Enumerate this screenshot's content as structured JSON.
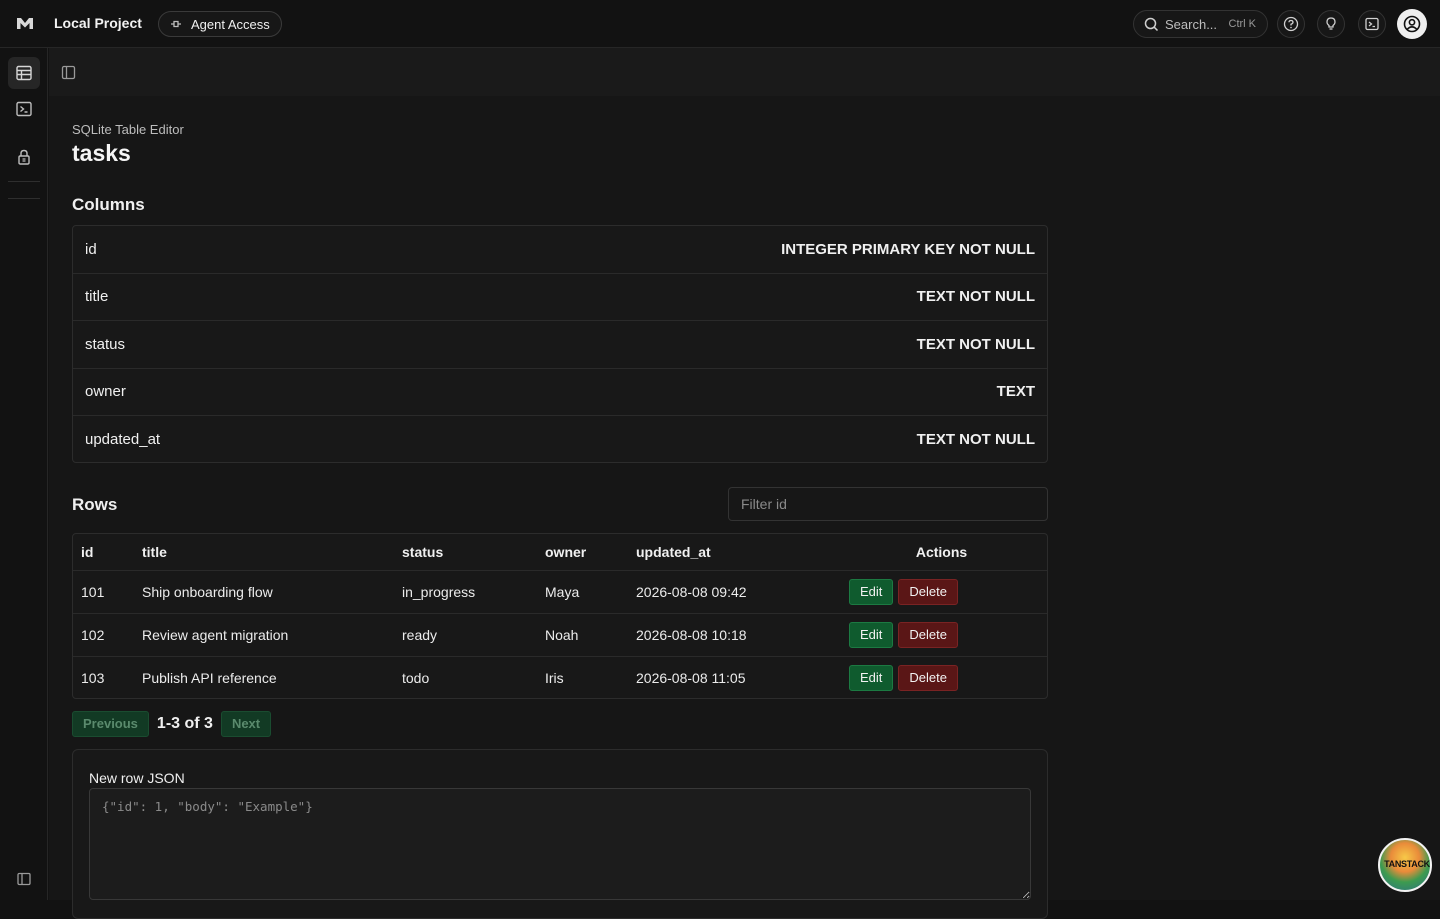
{
  "header": {
    "project_name": "Local Project",
    "agent_access_label": "Agent Access",
    "search_placeholder": "Search...",
    "search_shortcut": "Ctrl K"
  },
  "sidebar": {
    "items": [
      {
        "icon": "table-icon",
        "active": true
      },
      {
        "icon": "terminal-icon",
        "active": false
      },
      {
        "icon": "lock-icon",
        "active": false
      }
    ]
  },
  "page": {
    "kicker": "SQLite Table Editor",
    "title": "tasks"
  },
  "columns": {
    "label": "Columns",
    "items": [
      {
        "name": "id",
        "type": "INTEGER PRIMARY KEY NOT NULL"
      },
      {
        "name": "title",
        "type": "TEXT NOT NULL"
      },
      {
        "name": "status",
        "type": "TEXT NOT NULL"
      },
      {
        "name": "owner",
        "type": "TEXT"
      },
      {
        "name": "updated_at",
        "type": "TEXT NOT NULL"
      }
    ]
  },
  "rows": {
    "label": "Rows",
    "filter_placeholder": "Filter id",
    "headers": [
      "id",
      "title",
      "status",
      "owner",
      "updated_at",
      "Actions"
    ],
    "edit_label": "Edit",
    "delete_label": "Delete",
    "items": [
      {
        "id": "101",
        "title": "Ship onboarding flow",
        "status": "in_progress",
        "owner": "Maya",
        "updated_at": "2026-08-08 09:42"
      },
      {
        "id": "102",
        "title": "Review agent migration",
        "status": "ready",
        "owner": "Noah",
        "updated_at": "2026-08-08 10:18"
      },
      {
        "id": "103",
        "title": "Publish API reference",
        "status": "todo",
        "owner": "Iris",
        "updated_at": "2026-08-08 11:05"
      }
    ]
  },
  "pagination": {
    "previous_label": "Previous",
    "range_text": "1-3 of 3",
    "next_label": "Next"
  },
  "new_row": {
    "label": "New row JSON",
    "placeholder": "{\"id\": 1, \"body\": \"Example\"}"
  },
  "badge": {
    "label": "TANSTACK"
  }
}
